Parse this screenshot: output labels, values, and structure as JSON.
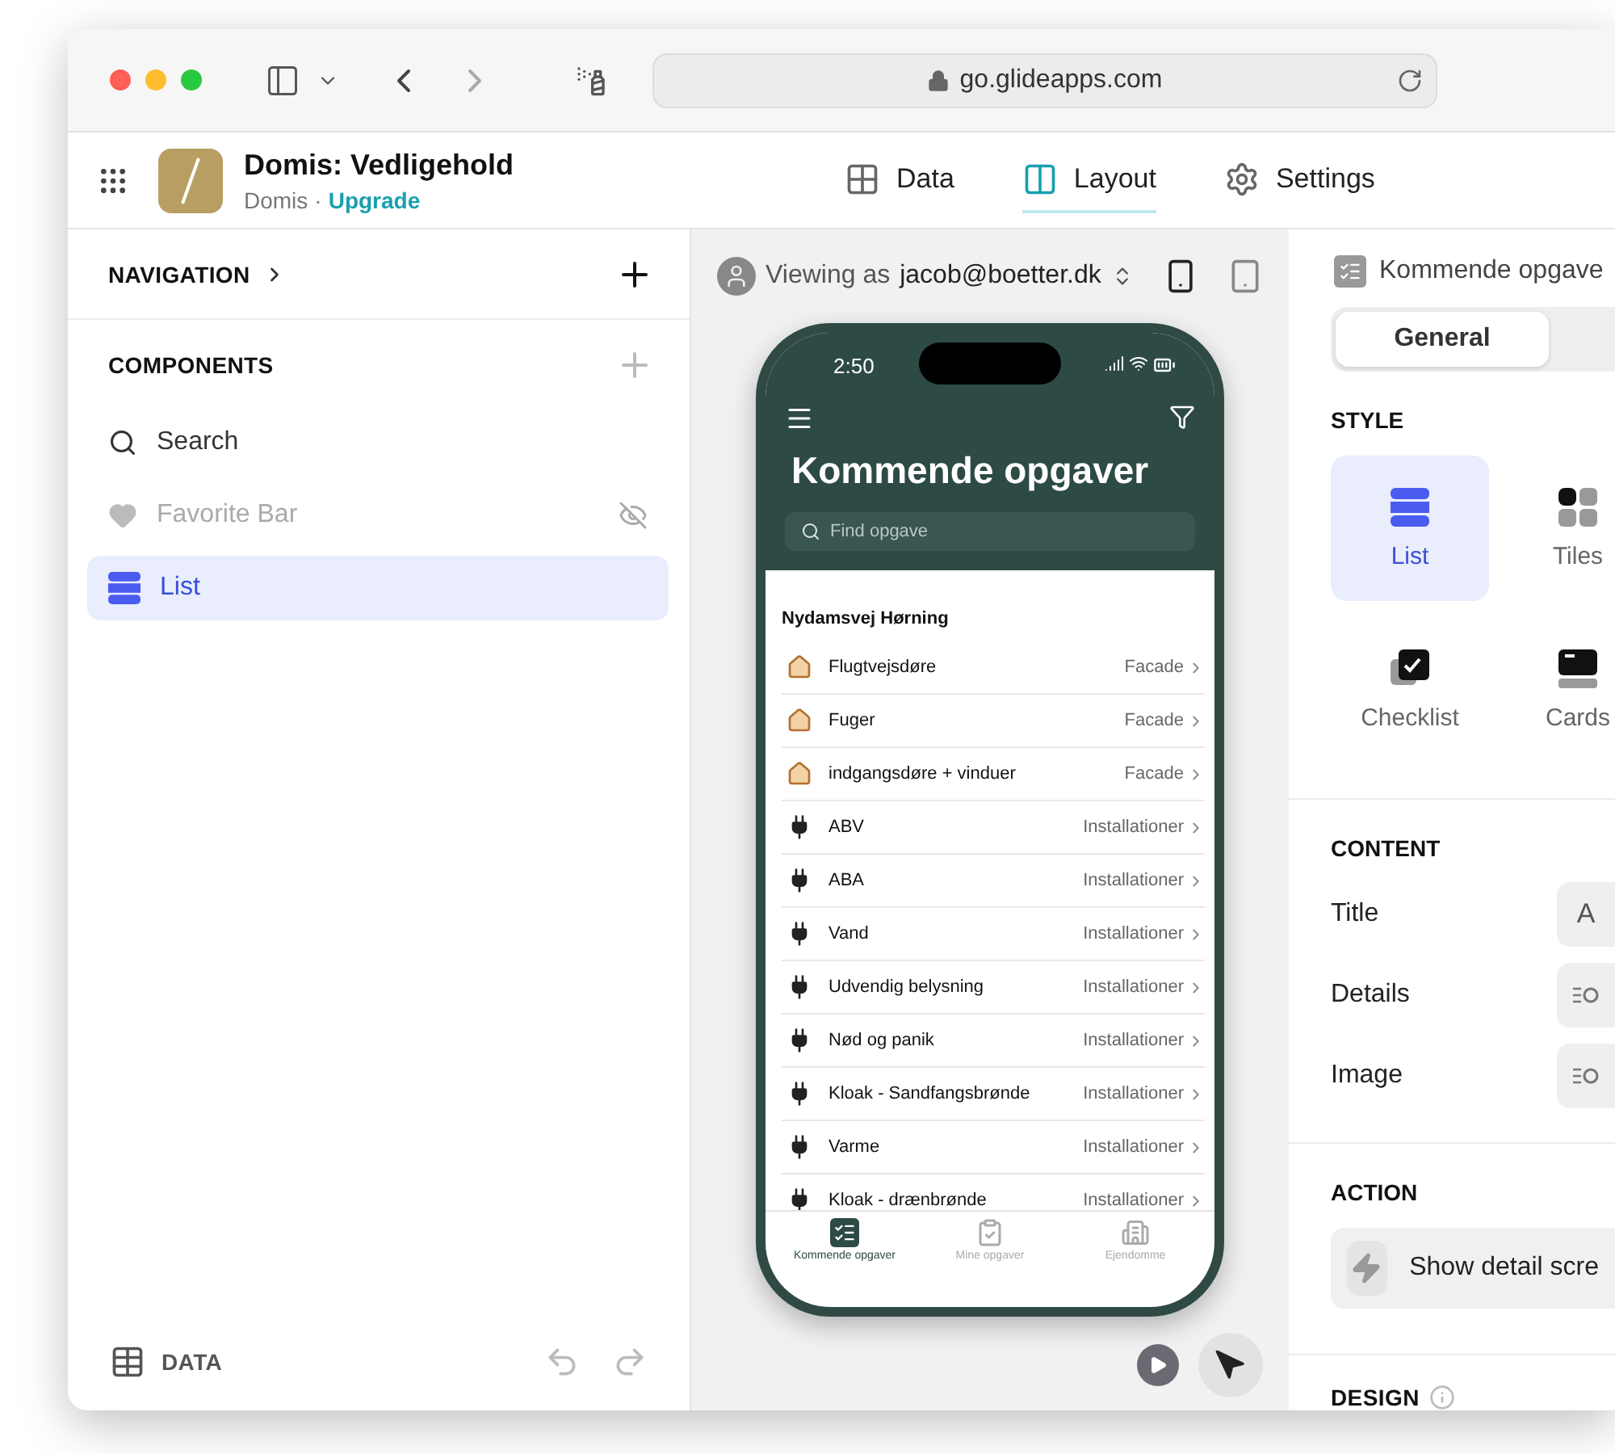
{
  "browser": {
    "url": "go.glideapps.com"
  },
  "app": {
    "name": "Domis: Vedligehold",
    "org": "Domis",
    "separator": "·",
    "upgrade": "Upgrade"
  },
  "top_tabs": [
    {
      "label": "Data",
      "kind": "data",
      "selected": false
    },
    {
      "label": "Layout",
      "kind": "layout",
      "selected": true
    },
    {
      "label": "Settings",
      "kind": "settings",
      "selected": false
    }
  ],
  "left_panel": {
    "navigation": "NAVIGATION",
    "components_heading": "COMPONENTS",
    "components": [
      {
        "label": "Search",
        "kind": "search",
        "selected": false,
        "hidden": false
      },
      {
        "label": "Favorite Bar",
        "kind": "favorite",
        "selected": false,
        "hidden": true
      },
      {
        "label": "List",
        "kind": "list",
        "selected": true,
        "hidden": false
      }
    ],
    "footer": "DATA"
  },
  "preview": {
    "viewing_as": "Viewing as",
    "user": "jacob@boetter.dk",
    "phone": {
      "time": "2:50",
      "title": "Kommende opgaver",
      "search_placeholder": "Find opgave",
      "group": "Nydamsvej Hørning",
      "rows": [
        {
          "title": "Flugtvejsdøre",
          "category": "Facade",
          "kind": "house"
        },
        {
          "title": "Fuger",
          "category": "Facade",
          "kind": "house"
        },
        {
          "title": "indgangsdøre + vinduer",
          "category": "Facade",
          "kind": "house"
        },
        {
          "title": "ABV",
          "category": "Installationer",
          "kind": "plug"
        },
        {
          "title": "ABA",
          "category": "Installationer",
          "kind": "plug"
        },
        {
          "title": "Vand",
          "category": "Installationer",
          "kind": "plug"
        },
        {
          "title": "Udvendig belysning",
          "category": "Installationer",
          "kind": "plug"
        },
        {
          "title": "Nød og panik",
          "category": "Installationer",
          "kind": "plug"
        },
        {
          "title": "Kloak - Sandfangsbrønde",
          "category": "Installationer",
          "kind": "plug"
        },
        {
          "title": "Varme",
          "category": "Installationer",
          "kind": "plug"
        },
        {
          "title": "Kloak - drænbrønde",
          "category": "Installationer",
          "kind": "plug"
        }
      ],
      "tab_bar": [
        {
          "label": "Kommende opgaver",
          "kind": "tasks",
          "selected": true
        },
        {
          "label": "Mine opgaver",
          "kind": "mine",
          "selected": false
        },
        {
          "label": "Ejendomme",
          "kind": "buildings",
          "selected": false
        }
      ]
    }
  },
  "right_panel": {
    "component_title": "Kommende opgave",
    "tabs": [
      {
        "label": "General",
        "selected": true
      }
    ],
    "style_heading": "STYLE",
    "styles": [
      {
        "label": "List",
        "kind": "list",
        "selected": true
      },
      {
        "label": "Tiles",
        "kind": "tiles",
        "selected": false
      },
      {
        "label": "Checklist",
        "kind": "checklist",
        "selected": false
      },
      {
        "label": "Cards",
        "kind": "cards",
        "selected": false
      }
    ],
    "content_heading": "CONTENT",
    "content_fields": [
      {
        "label": "Title",
        "value": "A",
        "kind": "text"
      },
      {
        "label": "Details",
        "kind": "query"
      },
      {
        "label": "Image",
        "kind": "query"
      }
    ],
    "action_heading": "ACTION",
    "action": "Show detail scre",
    "design_heading": "DESIGN"
  }
}
